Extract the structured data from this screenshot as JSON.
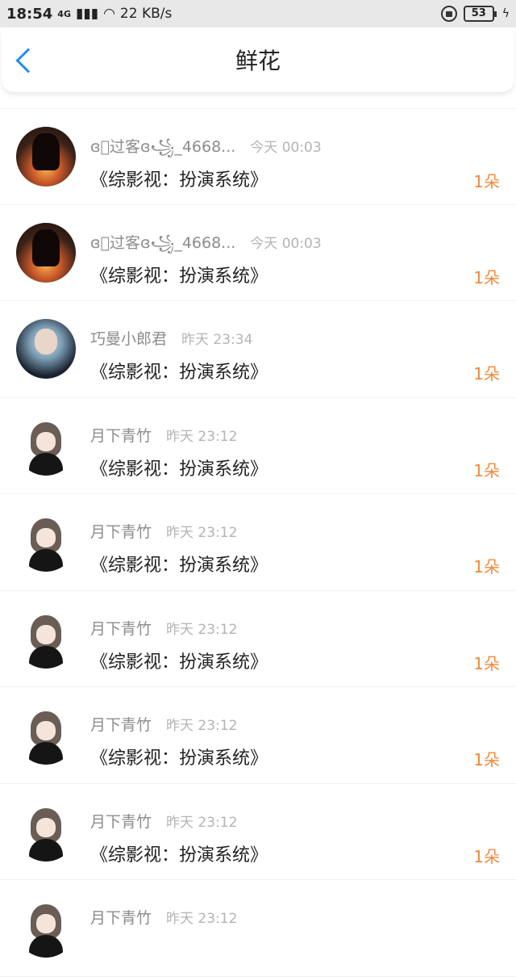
{
  "status": {
    "time": "18:54",
    "network": "4G",
    "speed": "22 KB/s",
    "battery": "53"
  },
  "header": {
    "title": "鲜花"
  },
  "colors": {
    "accent": "#2b8de8",
    "count": "#f08a3c"
  },
  "rows": [
    {
      "name": "ɞ⃟过客ɞ꧁_4668...",
      "time": "今天 00:03",
      "book": "《综影视：扮演系统》",
      "count": "1朵",
      "avatar": "sunset-silhouette"
    },
    {
      "name": "ɞ⃟过客ɞ꧁_4668...",
      "time": "今天 00:03",
      "book": "《综影视：扮演系统》",
      "count": "1朵",
      "avatar": "sunset-silhouette"
    },
    {
      "name": "巧曼小郎君",
      "time": "昨天 23:34",
      "book": "《综影视：扮演系统》",
      "count": "1朵",
      "avatar": "boy-portrait"
    },
    {
      "name": "月下青竹",
      "time": "昨天 23:12",
      "book": "《综影视：扮演系统》",
      "count": "1朵",
      "avatar": "anime-girl"
    },
    {
      "name": "月下青竹",
      "time": "昨天 23:12",
      "book": "《综影视：扮演系统》",
      "count": "1朵",
      "avatar": "anime-girl"
    },
    {
      "name": "月下青竹",
      "time": "昨天 23:12",
      "book": "《综影视：扮演系统》",
      "count": "1朵",
      "avatar": "anime-girl"
    },
    {
      "name": "月下青竹",
      "time": "昨天 23:12",
      "book": "《综影视：扮演系统》",
      "count": "1朵",
      "avatar": "anime-girl"
    },
    {
      "name": "月下青竹",
      "time": "昨天 23:12",
      "book": "《综影视：扮演系统》",
      "count": "1朵",
      "avatar": "anime-girl"
    },
    {
      "name": "月下青竹",
      "time": "昨天 23:12",
      "book": "",
      "count": "",
      "avatar": "anime-girl"
    }
  ]
}
